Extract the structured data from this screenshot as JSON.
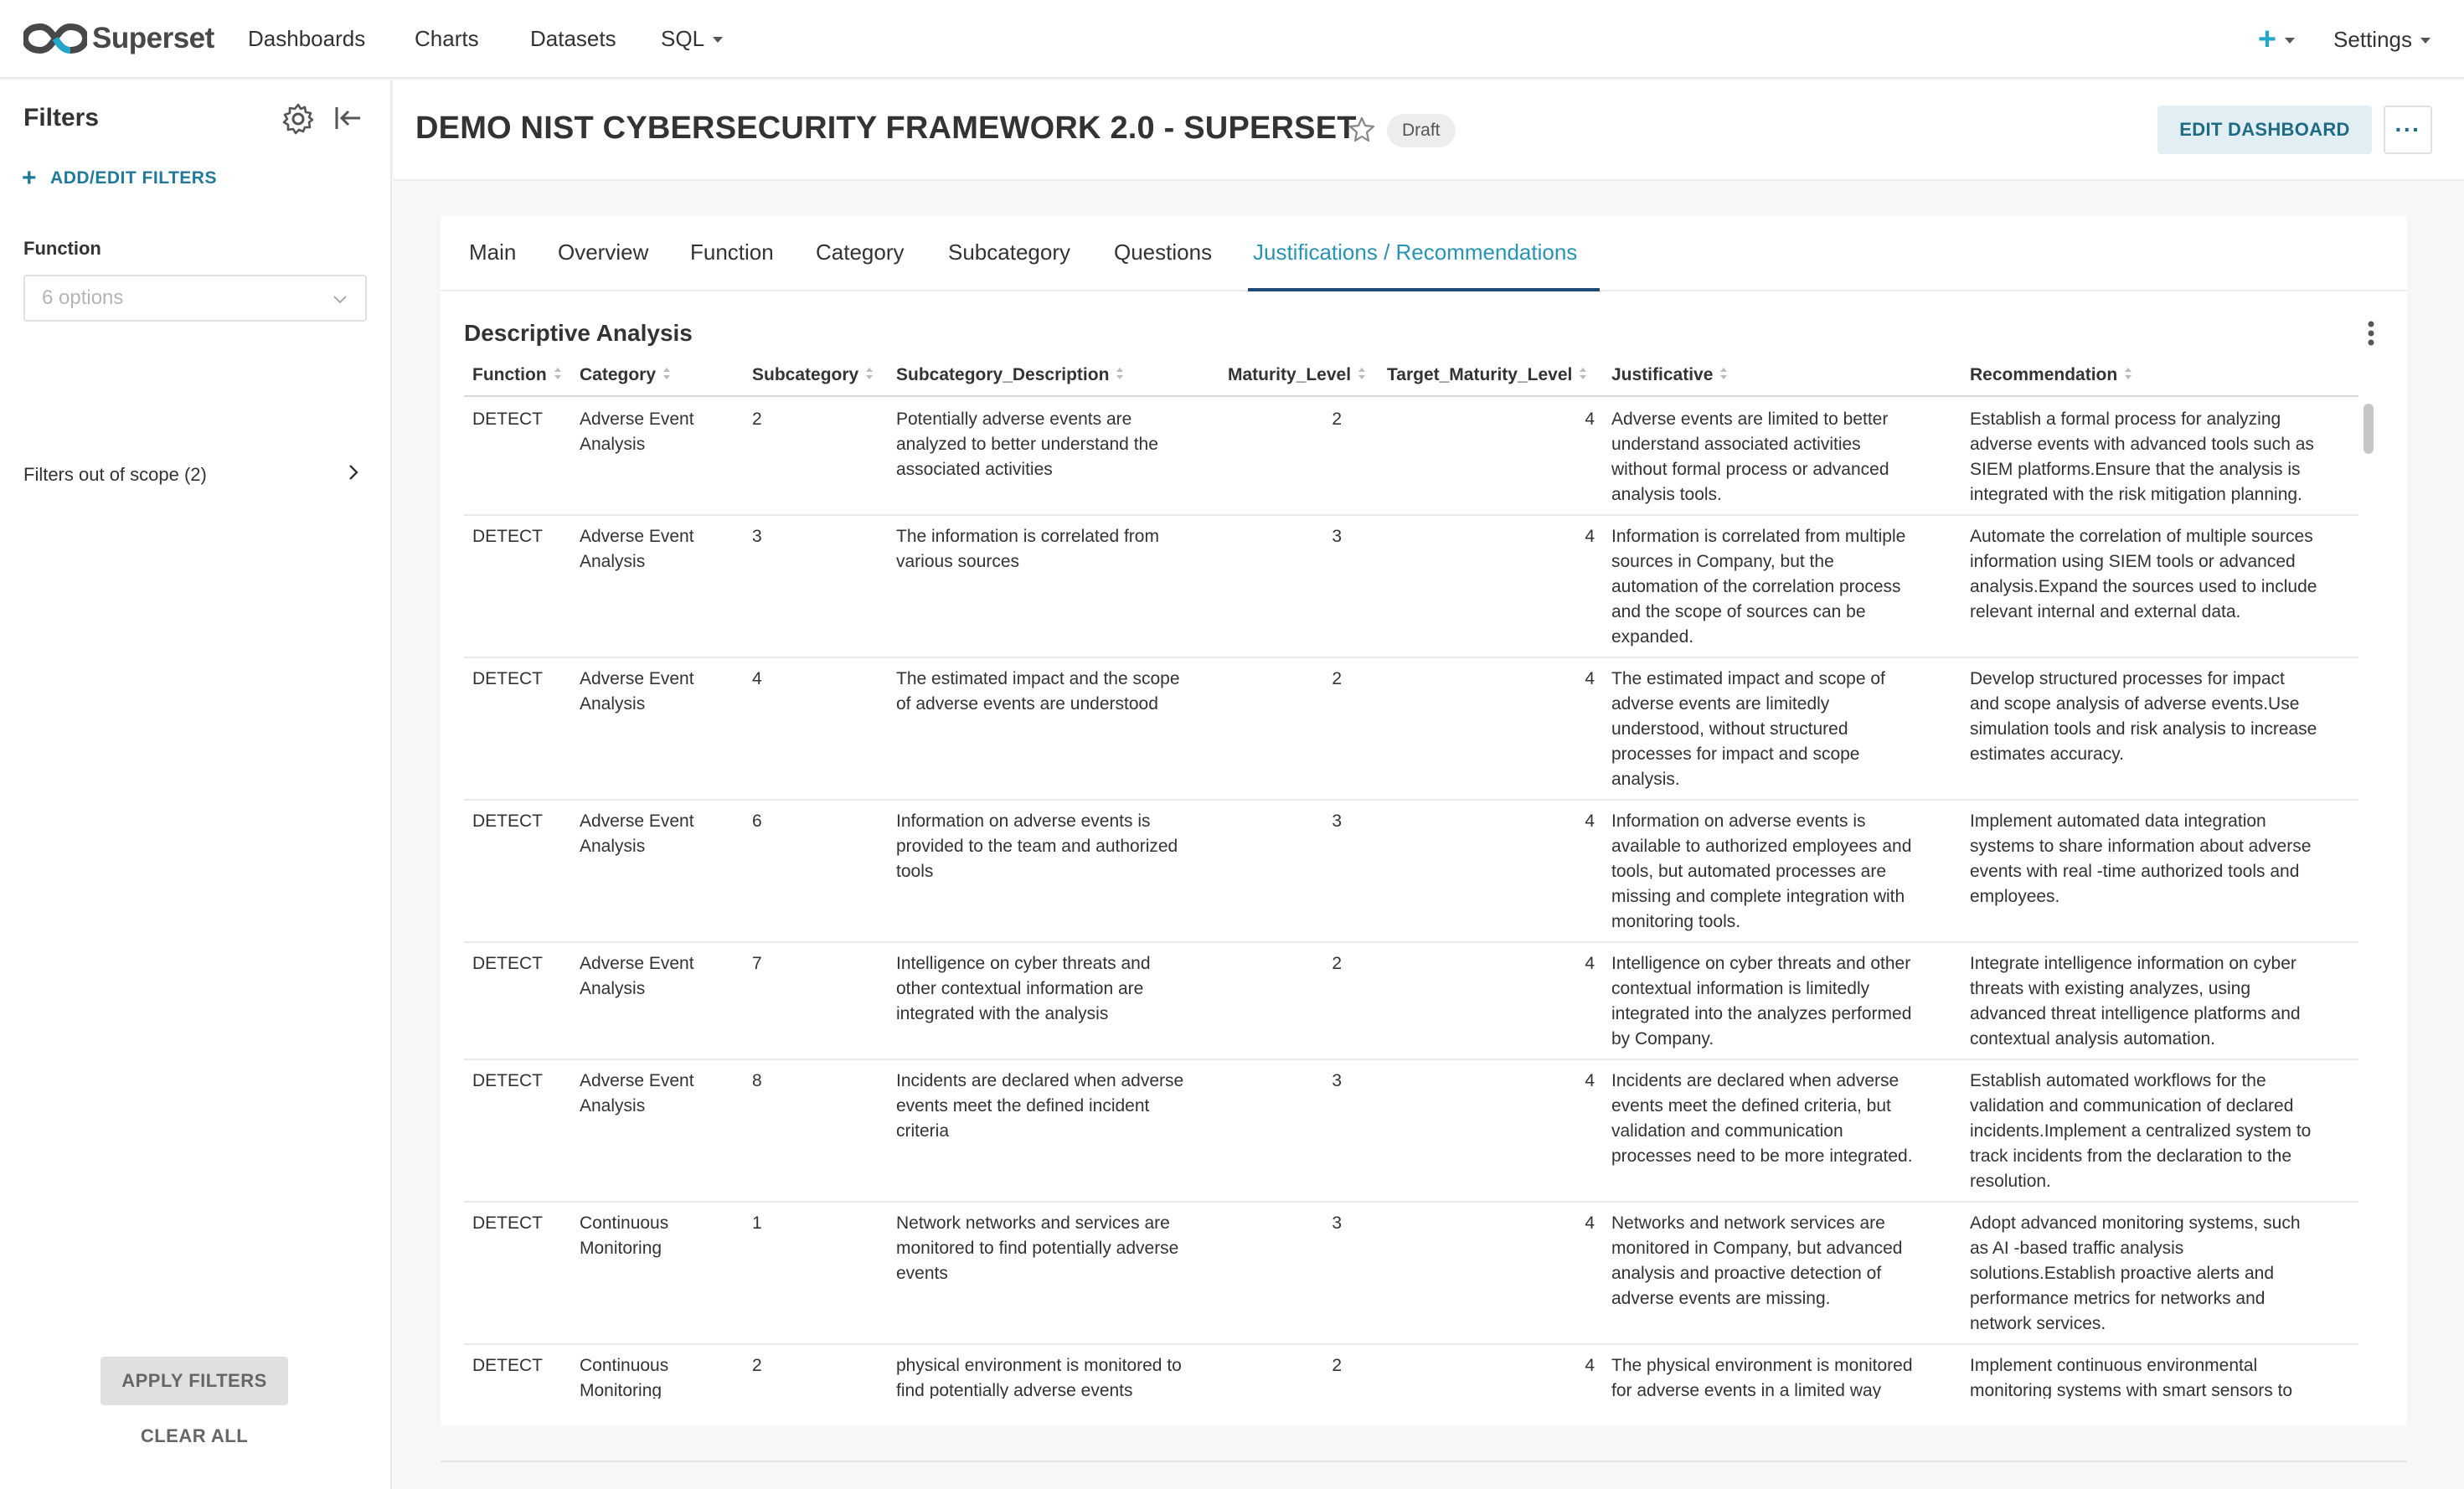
{
  "navbar": {
    "brand": "Superset",
    "items": [
      "Dashboards",
      "Charts",
      "Datasets",
      "SQL"
    ],
    "plus_label": "+",
    "settings_label": "Settings"
  },
  "sidebar": {
    "title": "Filters",
    "add_edit_label": "ADD/EDIT FILTERS",
    "function_label": "Function",
    "function_placeholder": "6 options",
    "out_of_scope_label": "Filters out of scope (2)",
    "apply_label": "APPLY FILTERS",
    "clear_label": "CLEAR ALL"
  },
  "dashboard": {
    "title": "DEMO NIST CYBERSECURITY FRAMEWORK 2.0 - SUPERSET",
    "status": "Draft",
    "edit_label": "EDIT DASHBOARD",
    "more_label": "···"
  },
  "tabs": [
    "Main",
    "Overview",
    "Function",
    "Category",
    "Subcategory",
    "Questions",
    "Justifications / Recommendations"
  ],
  "active_tab": "Justifications / Recommendations",
  "chart": {
    "title": "Descriptive Analysis",
    "columns": [
      "Function",
      "Category",
      "Subcategory",
      "Subcategory_Description",
      "Maturity_Level",
      "Target_Maturity_Level",
      "Justificative",
      "Recommendation"
    ],
    "rows": [
      {
        "function": "DETECT",
        "category": [
          "Adverse Event",
          "Analysis"
        ],
        "subcategory": "2",
        "description": [
          "Potentially adverse events are",
          "analyzed to better understand the",
          "associated activities"
        ],
        "maturity": "2",
        "target": "4",
        "justificative": [
          "Adverse events are limited to better",
          "understand associated activities",
          "without formal process or advanced",
          "analysis tools."
        ],
        "recommendation": [
          "Establish a formal process for analyzing",
          "adverse events with advanced tools such as",
          "SIEM platforms.Ensure that the analysis is",
          "integrated with the risk mitigation planning."
        ]
      },
      {
        "function": "DETECT",
        "category": [
          "Adverse Event",
          "Analysis"
        ],
        "subcategory": "3",
        "description": [
          "The information is correlated from",
          "various sources"
        ],
        "maturity": "3",
        "target": "4",
        "justificative": [
          "Information is correlated from multiple",
          "sources in Company, but the",
          "automation of the correlation process",
          "and the scope of sources can be",
          "expanded."
        ],
        "recommendation": [
          "Automate the correlation of multiple sources",
          "information using SIEM tools or advanced",
          "analysis.Expand the sources used to include",
          "relevant internal and external data."
        ]
      },
      {
        "function": "DETECT",
        "category": [
          "Adverse Event",
          "Analysis"
        ],
        "subcategory": "4",
        "description": [
          "The estimated impact and the scope",
          "of adverse events are understood"
        ],
        "maturity": "2",
        "target": "4",
        "justificative": [
          "The estimated impact and scope of",
          "adverse events are limitedly",
          "understood, without structured",
          "processes for impact and scope",
          "analysis."
        ],
        "recommendation": [
          "Develop structured processes for impact",
          "and scope analysis of adverse events.Use",
          "simulation tools and risk analysis to increase",
          "estimates accuracy."
        ]
      },
      {
        "function": "DETECT",
        "category": [
          "Adverse Event",
          "Analysis"
        ],
        "subcategory": "6",
        "description": [
          "Information on adverse events is",
          "provided to the team and authorized",
          "tools"
        ],
        "maturity": "3",
        "target": "4",
        "justificative": [
          "Information on adverse events is",
          "available to authorized employees and",
          "tools, but automated processes are",
          "missing and complete integration with",
          "monitoring tools."
        ],
        "recommendation": [
          "Implement automated data integration",
          "systems to share information about adverse",
          "events with real -time authorized tools and",
          "employees."
        ]
      },
      {
        "function": "DETECT",
        "category": [
          "Adverse Event",
          "Analysis"
        ],
        "subcategory": "7",
        "description": [
          "Intelligence on cyber threats and",
          "other contextual information are",
          "integrated with the analysis"
        ],
        "maturity": "2",
        "target": "4",
        "justificative": [
          "Intelligence on cyber threats and other",
          "contextual information is limitedly",
          "integrated into the analyzes performed",
          "by Company."
        ],
        "recommendation": [
          "Integrate intelligence information on cyber",
          "threats with existing analyzes, using",
          "advanced threat intelligence platforms and",
          "contextual analysis automation."
        ]
      },
      {
        "function": "DETECT",
        "category": [
          "Adverse Event",
          "Analysis"
        ],
        "subcategory": "8",
        "description": [
          "Incidents are declared when adverse",
          "events meet the defined incident",
          "criteria"
        ],
        "maturity": "3",
        "target": "4",
        "justificative": [
          "Incidents are declared when adverse",
          "events meet the defined criteria, but",
          "validation and communication",
          "processes need to be more integrated."
        ],
        "recommendation": [
          "Establish automated workflows for the",
          "validation and communication of declared",
          "incidents.Implement a centralized system to",
          "track incidents from the declaration to the",
          "resolution."
        ]
      },
      {
        "function": "DETECT",
        "category": [
          "Continuous",
          "Monitoring"
        ],
        "subcategory": "1",
        "description": [
          "Network networks and services are",
          "monitored to find potentially adverse",
          "events"
        ],
        "maturity": "3",
        "target": "4",
        "justificative": [
          "Networks and network services are",
          "monitored in Company, but advanced",
          "analysis and proactive detection of",
          "adverse events are missing."
        ],
        "recommendation": [
          "Adopt advanced monitoring systems, such",
          "as AI -based traffic analysis",
          "solutions.Establish proactive alerts and",
          "performance metrics for networks and",
          "network services."
        ]
      },
      {
        "function": "DETECT",
        "category": [
          "Continuous",
          "Monitoring"
        ],
        "subcategory": "2",
        "description": [
          "physical environment is monitored to",
          "find potentially adverse events"
        ],
        "maturity": "2",
        "target": "4",
        "justificative": [
          "The physical environment is monitored",
          "for adverse events in a limited way"
        ],
        "recommendation": [
          "Implement continuous environmental",
          "monitoring systems with smart sensors to"
        ]
      }
    ]
  }
}
